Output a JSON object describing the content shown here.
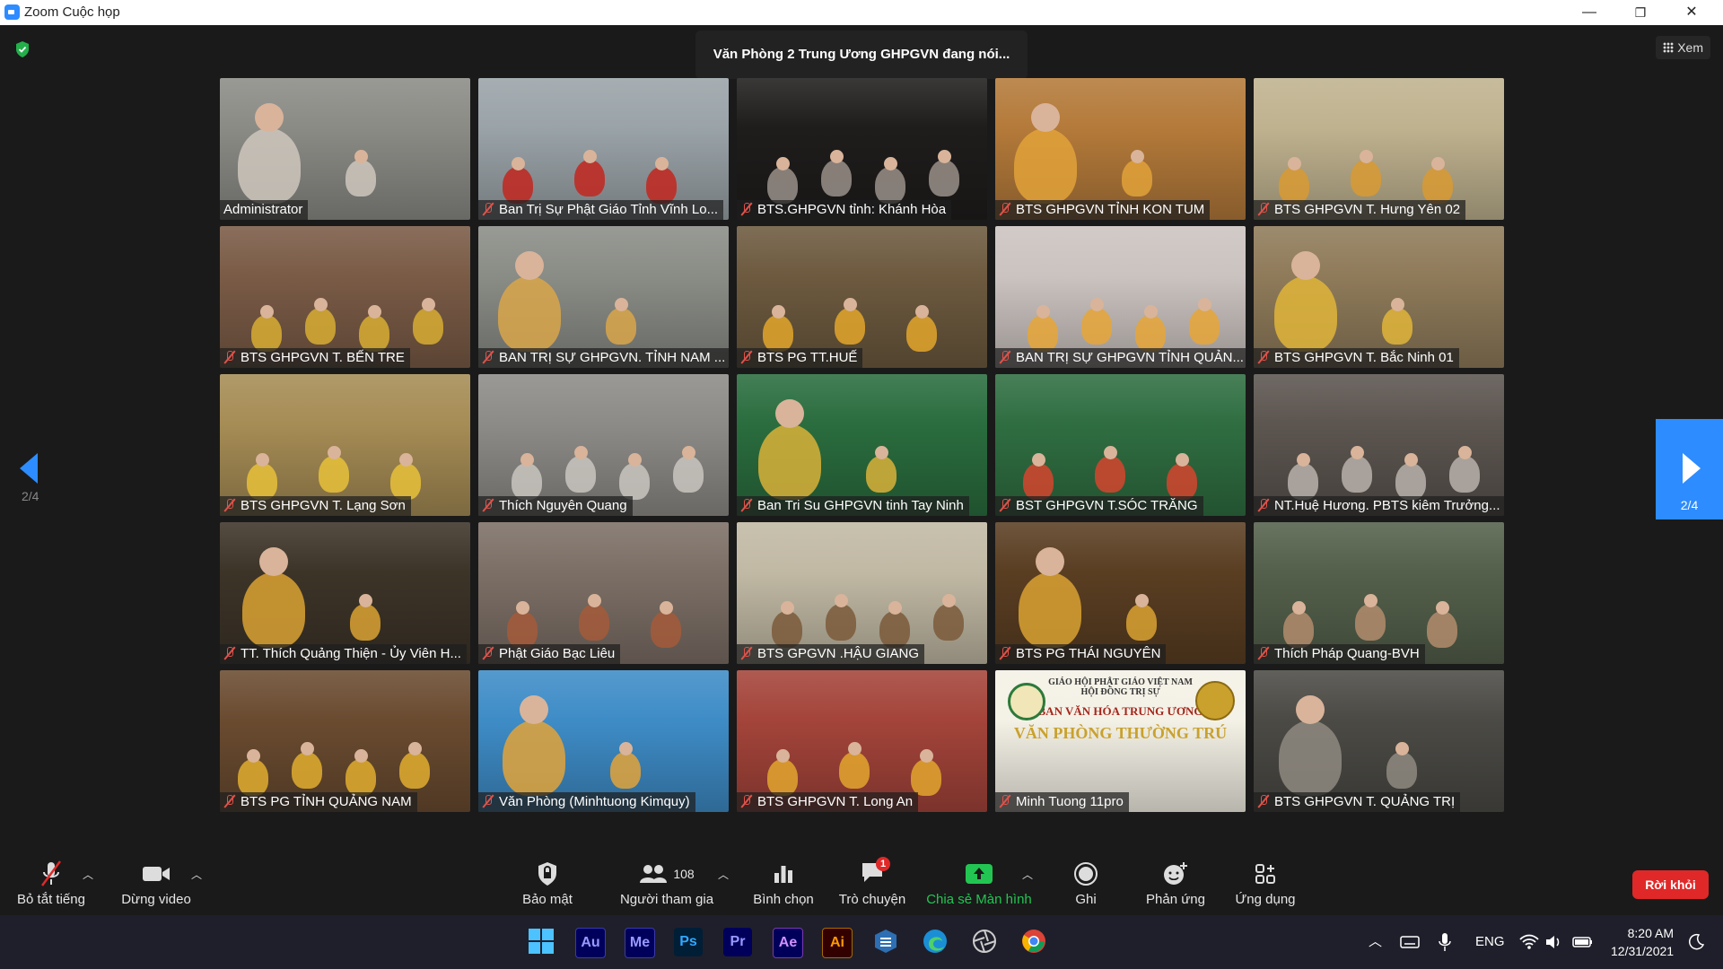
{
  "window": {
    "title": "Zoom Cuộc họp",
    "minimize": "—",
    "restore": "❐",
    "close": "✕"
  },
  "meeting": {
    "speaker_banner": "Văn Phòng 2 Trung Ương GHPGVN đang nói...",
    "view_label": "Xem",
    "page_indicator": "2/4",
    "participants": [
      {
        "name": "Administrator",
        "muted": false,
        "bg": "#8b8b86",
        "accent": "#cfc7bd"
      },
      {
        "name": "Ban Trị Sự Phật Giáo Tỉnh Vĩnh Lo...",
        "muted": true,
        "bg": "#9aa3a8",
        "accent": "#c2271f"
      },
      {
        "name": "BTS.GHPGVN tỉnh: Khánh Hòa",
        "muted": true,
        "bg": "#1f1d1c",
        "accent": "#9a9189"
      },
      {
        "name": "BTS GHPGVN TỈNH KON TUM",
        "muted": true,
        "bg": "#b47a3a",
        "accent": "#e2a23a"
      },
      {
        "name": "BTS GHPGVN T. Hưng Yên 02",
        "muted": true,
        "bg": "#bfb28f",
        "accent": "#d89a33"
      },
      {
        "name": "BTS GHPGVN T. BẾN TRE",
        "muted": true,
        "bg": "#7a5b46",
        "accent": "#d7ad32"
      },
      {
        "name": "BAN TRỊ SỰ GHPGVN. TỈNH NAM ...",
        "muted": true,
        "bg": "#8a8c86",
        "accent": "#d9a64a"
      },
      {
        "name": "BTS PG TT.HUẾ",
        "muted": true,
        "bg": "#6d5a3f",
        "accent": "#e3a62b"
      },
      {
        "name": "BAN TRỊ SỰ GHPGVN TỈNH QUẢN...",
        "muted": true,
        "bg": "#cbc3c0",
        "accent": "#e6a637"
      },
      {
        "name": "BTS GHPGVN T. Bắc Ninh 01",
        "muted": true,
        "bg": "#8f7b5a",
        "accent": "#e0b53a"
      },
      {
        "name": "BTS GHPGVN T. Lạng Sơn",
        "muted": true,
        "bg": "#a68c55",
        "accent": "#e8c13a"
      },
      {
        "name": "Thích Nguyên Quang",
        "muted": true,
        "bg": "#8d8b87",
        "accent": "#c9c6bf"
      },
      {
        "name": "Ban Tri Su GHPGVN tinh Tay Ninh",
        "muted": true,
        "bg": "#2a6d3e",
        "accent": "#d9b23a"
      },
      {
        "name": "BST GHPGVN T.SÓC TRĂNG",
        "muted": true,
        "bg": "#2f6e41",
        "accent": "#d4452e"
      },
      {
        "name": "NT.Huệ Hương. PBTS kiêm Trưởng...",
        "muted": true,
        "bg": "#5c5550",
        "accent": "#b9b2ab"
      },
      {
        "name": "TT. Thích Quảng Thiện - Ủy Viên H...",
        "muted": true,
        "bg": "#3d3428",
        "accent": "#dba232"
      },
      {
        "name": "Phật Giáo Bạc Liêu",
        "muted": true,
        "bg": "#7c6f66",
        "accent": "#a55a3a"
      },
      {
        "name": "BTS GPGVN .HẬU GIANG",
        "muted": true,
        "bg": "#c1b9a4",
        "accent": "#7b5a3a"
      },
      {
        "name": "BTS PG THÁI NGUYÊN",
        "muted": true,
        "bg": "#5a3e22",
        "accent": "#d9a233"
      },
      {
        "name": "Thích Pháp Quang-BVH",
        "muted": true,
        "bg": "#54604b",
        "accent": "#b38c6c"
      },
      {
        "name": "BTS PG TỈNH QUẢNG NAM",
        "muted": true,
        "bg": "#6a4b30",
        "accent": "#e0ae2f"
      },
      {
        "name": "Văn Phòng (Minhtuong Kimquy)",
        "muted": true,
        "bg": "#3e8cc7",
        "accent": "#e2a33a"
      },
      {
        "name": "BTS GHPGVN T. Long An",
        "muted": true,
        "bg": "#a4443a",
        "accent": "#e3a62e"
      },
      {
        "name": "Minh Tuong 11pro",
        "muted": true,
        "bg": "#f4f1e6",
        "accent": "#c9a12c",
        "card": {
          "line1": "GIÁO HỘI PHẬT GIÁO VIỆT NAM",
          "line2": "HỘI ĐỒNG TRỊ SỰ",
          "line3": "BAN VĂN HÓA TRUNG ƯƠNG",
          "line4": "VĂN PHÒNG THƯỜNG TRÚ"
        }
      },
      {
        "name": "BTS GHPGVN T. QUẢNG TRỊ",
        "muted": true,
        "bg": "#4b4a45",
        "accent": "#8f8a80"
      }
    ]
  },
  "toolbar": {
    "mute": "Bỏ tắt tiếng",
    "video": "Dừng video",
    "security": "Bảo mật",
    "participants": "Người tham gia",
    "participant_count": "108",
    "polls": "Bình chọn",
    "chat": "Trò chuyện",
    "chat_badge": "1",
    "share": "Chia sẻ Màn hình",
    "record": "Ghi",
    "reactions": "Phản ứng",
    "apps": "Ứng dụng",
    "leave": "Rời khỏi"
  },
  "taskbar": {
    "apps": [
      {
        "name": "windows-start",
        "label": ""
      },
      {
        "name": "audition",
        "label": "Au"
      },
      {
        "name": "media-encoder",
        "label": "Me"
      },
      {
        "name": "photoshop",
        "label": "Ps"
      },
      {
        "name": "premiere",
        "label": "Pr"
      },
      {
        "name": "after-effects",
        "label": "Ae"
      },
      {
        "name": "illustrator",
        "label": "Ai"
      },
      {
        "name": "app-cube",
        "label": ""
      },
      {
        "name": "edge",
        "label": ""
      },
      {
        "name": "app-circle",
        "label": ""
      },
      {
        "name": "chrome",
        "label": ""
      }
    ],
    "language": "ENG",
    "time": "8:20 AM",
    "date": "12/31/2021"
  }
}
